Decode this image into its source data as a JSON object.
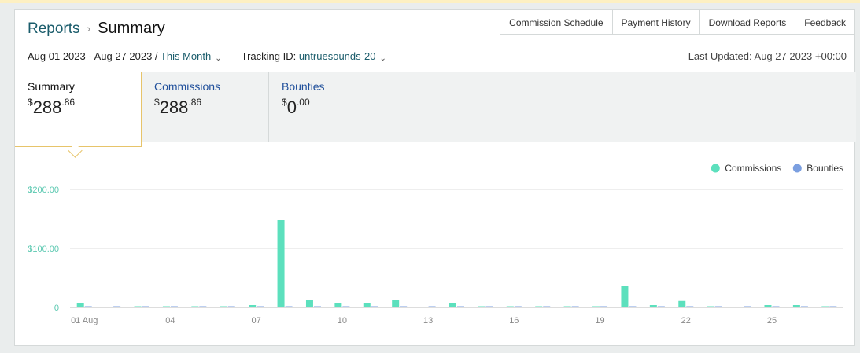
{
  "breadcrumb": {
    "link": "Reports",
    "separator": "›",
    "current": "Summary"
  },
  "header_buttons": [
    "Commission Schedule",
    "Payment History",
    "Download Reports",
    "Feedback"
  ],
  "filters": {
    "date_range": "Aug 01 2023 - Aug 27 2023 /",
    "period": "This Month",
    "tracking_label": "Tracking ID:",
    "tracking_id": "untruesounds-20"
  },
  "last_updated": "Last Updated: Aug 27 2023 +00:00",
  "tabs": [
    {
      "label": "Summary",
      "currency": "$",
      "whole": "288",
      "cents": ".86"
    },
    {
      "label": "Commissions",
      "currency": "$",
      "whole": "288",
      "cents": ".86"
    },
    {
      "label": "Bounties",
      "currency": "$",
      "whole": "0",
      "cents": ".00"
    }
  ],
  "colors": {
    "commissions": "#5ce0bd",
    "bounties": "#7b9fe0",
    "axis_text": "#5ac8b0",
    "grid": "#dddddd"
  },
  "chart_data": {
    "type": "bar",
    "legend_position": "top-right",
    "grid": true,
    "ylim": [
      0,
      200
    ],
    "yticks": [
      "$200.00",
      "$100.00",
      "0"
    ],
    "ytick_values": [
      200,
      100,
      0
    ],
    "xtick_labels": [
      "01 Aug",
      "04",
      "07",
      "10",
      "13",
      "16",
      "19",
      "22",
      "25"
    ],
    "xtick_days": [
      1,
      4,
      7,
      10,
      13,
      16,
      19,
      22,
      25
    ],
    "days": [
      1,
      2,
      3,
      4,
      5,
      6,
      7,
      8,
      9,
      10,
      11,
      12,
      13,
      14,
      15,
      16,
      17,
      18,
      19,
      20,
      21,
      22,
      23,
      24,
      25,
      26,
      27
    ],
    "series": [
      {
        "name": "Commissions",
        "values": [
          7,
          0,
          2,
          2,
          2,
          2,
          4,
          148,
          13,
          7,
          7,
          12,
          0,
          8,
          2,
          2,
          2,
          2,
          2,
          36,
          4,
          11,
          2,
          0,
          4,
          4,
          2
        ]
      },
      {
        "name": "Bounties",
        "values": [
          2,
          2,
          2,
          2,
          2,
          2,
          2,
          2,
          2,
          2,
          2,
          2,
          2,
          2,
          2,
          2,
          2,
          2,
          2,
          2,
          2,
          2,
          2,
          2,
          2,
          2,
          2
        ]
      }
    ]
  }
}
